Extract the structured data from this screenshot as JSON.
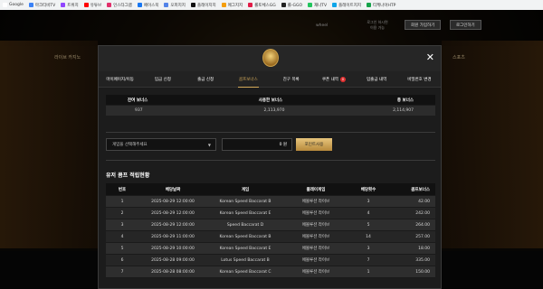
{
  "bookmarks": [
    {
      "label": "Google",
      "color": "#ffffff"
    },
    {
      "label": "마크티비TV",
      "color": "#3b82f6"
    },
    {
      "label": "트위치",
      "color": "#9146ff"
    },
    {
      "label": "유튜브",
      "color": "#ff0000"
    },
    {
      "label": "인스타그램",
      "color": "#e1306c"
    },
    {
      "label": "페이스북",
      "color": "#1877f2"
    },
    {
      "label": "오피지지",
      "color": "#5383e8"
    },
    {
      "label": "플레이지지",
      "color": "#111111"
    },
    {
      "label": "메그지지",
      "color": "#f59e0b"
    },
    {
      "label": "롤토체스GG",
      "color": "#e11d48"
    },
    {
      "label": "롤-GGO",
      "color": "#222222"
    },
    {
      "label": "재나TV",
      "color": "#22c55e"
    },
    {
      "label": "플레이트지지",
      "color": "#0ea5e9"
    },
    {
      "label": "티케나아HTP",
      "color": "#16a34a"
    }
  ],
  "background": {
    "nav_left": "라이브 카지노",
    "nav_right": "스포츠",
    "header_small": "wheel",
    "header_small2": "로그인 하시면\n이용 가능",
    "login_button": "회원 가입하기",
    "join_button": "로그인하기"
  },
  "modal": {
    "close_label": "✕",
    "tabs": [
      {
        "label": "마이페이지/이동",
        "active": false
      },
      {
        "label": "입금 신청",
        "active": false
      },
      {
        "label": "출금 신청",
        "active": false
      },
      {
        "label": "콤프보너스",
        "active": true
      },
      {
        "label": "친구 목록",
        "active": false
      },
      {
        "label": "쿠폰 내역",
        "active": false,
        "badge": "0"
      },
      {
        "label": "입출금 내역",
        "active": false
      },
      {
        "label": "비밀번호 변경",
        "active": false
      }
    ],
    "summary": {
      "headers": [
        "잔여 보너스",
        "사용한 보너스",
        "총 보너스"
      ],
      "values": [
        "937",
        "2,113,970",
        "2,114,907"
      ]
    },
    "convert": {
      "select_placeholder": "게임을 선택해주세요",
      "amount_value": "0 원",
      "button_label": "포인트사용"
    },
    "section_title": "유저 콤프 적립현황",
    "table": {
      "headers": [
        "번호",
        "배당날짜",
        "게임",
        "플레이게임",
        "배당횟수",
        "콤프보너스"
      ],
      "rows": [
        [
          "1",
          "2025-08-29 12:00:00",
          "Korean Speed Baccarat B",
          "에볼루션 라이브",
          "3",
          "42.00"
        ],
        [
          "2",
          "2025-08-29 12:00:00",
          "Korean Speed Baccarat E",
          "에볼루션 라이브",
          "4",
          "242.00"
        ],
        [
          "3",
          "2025-08-29 12:00:00",
          "Speed Baccarat D",
          "에볼루션 라이브",
          "5",
          "264.00"
        ],
        [
          "4",
          "2025-08-29 11:00:00",
          "Korean Speed Baccarat B",
          "에볼루션 라이브",
          "14",
          "257.00"
        ],
        [
          "5",
          "2025-08-29 10:00:00",
          "Korean Speed Baccarat E",
          "에볼루션 라이브",
          "3",
          "18.00"
        ],
        [
          "6",
          "2025-08-28 09:00:00",
          "Lotus Speed Baccarat B",
          "에볼루션 라이브",
          "7",
          "335.00"
        ],
        [
          "7",
          "2025-08-28 08:00:00",
          "Korean Speed Baccarat C",
          "에볼루션 라이브",
          "1",
          "150.00"
        ]
      ]
    }
  }
}
